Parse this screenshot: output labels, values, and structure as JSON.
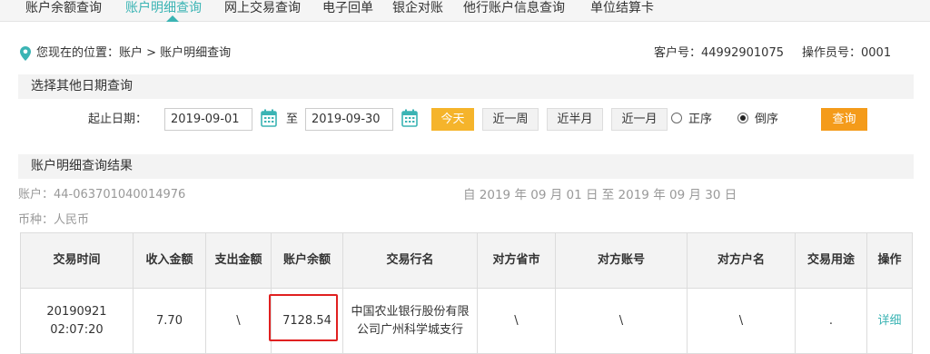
{
  "tabs": [
    {
      "label": "账户余额查询"
    },
    {
      "label": "账户明细查询"
    },
    {
      "label": "网上交易查询"
    },
    {
      "label": "电子回单"
    },
    {
      "label": "银企对账"
    },
    {
      "label": "他行账户信息查询"
    },
    {
      "label": "单位结算卡"
    }
  ],
  "breadcrumb": "您现在的位置：账户 > 账户明细查询",
  "customer": "客户号：44992901075",
  "operator": "操作员号：0001",
  "section_date": "选择其他日期查询",
  "filter": {
    "date_label": "起止日期：",
    "start_date": "2019-09-01",
    "to_label": "至",
    "end_date": "2019-09-30",
    "today_btn": "今天",
    "week_btn": "近一周",
    "halfmonth_btn": "近半月",
    "month_btn": "近一月",
    "asc_label": "正序",
    "desc_label": "倒序",
    "sort_selected": "desc",
    "query_btn": "查询"
  },
  "section_result": "账户明细查询结果",
  "account": "账户：44-063701040014976",
  "range_text": "自 2019 年 09 月 01 日 至 2019 年 09 月 30 日",
  "currency": "币种：人民币",
  "table": {
    "headers": [
      "交易时间",
      "收入金额",
      "支出金额",
      "账户余额",
      "交易行名",
      "对方省市",
      "对方账号",
      "对方户名",
      "交易用途",
      "操作"
    ],
    "rows": [
      {
        "date": "20190921",
        "time": "02:07:20",
        "income": "7.70",
        "expense": "\\",
        "balance": "7128.54",
        "bank": "中国农业银行股份有限公司广州科学城支行",
        "province": "\\",
        "account_no": "\\",
        "account_name": "\\",
        "purpose": ".",
        "action": "详细"
      }
    ]
  },
  "colors": {
    "accent": "#3bb4b4",
    "orange": "#f49b1a",
    "highlight": "#e02020"
  },
  "icons": {
    "location": "map-pin-icon",
    "calendar": "calendar-icon"
  }
}
